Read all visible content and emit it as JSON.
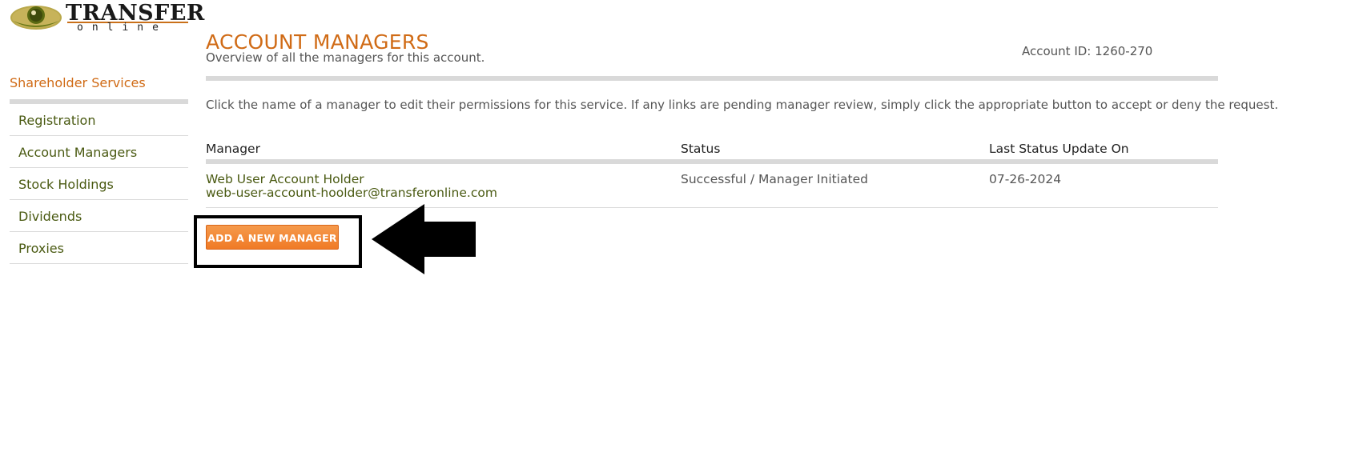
{
  "logo": {
    "main_text": "TRANSFER",
    "sub_text": "online",
    "icon": "eye-logo-icon",
    "colors": {
      "olive": "#6b7a18",
      "orange": "#c9701a"
    }
  },
  "sidebar": {
    "section_title": "Shareholder Services",
    "items": [
      {
        "label": "Registration"
      },
      {
        "label": "Account Managers"
      },
      {
        "label": "Stock Holdings"
      },
      {
        "label": "Dividends"
      },
      {
        "label": "Proxies"
      }
    ]
  },
  "header": {
    "title": "ACCOUNT MANAGERS",
    "subtitle": "Overview of all the managers for this account.",
    "account_id_label": "Account ID: 1260-270"
  },
  "instructions": "Click the name of a manager to edit their permissions for this service. If any links are pending manager review, simply click the appropriate button to accept or deny the request.",
  "table": {
    "columns": [
      "Manager",
      "Status",
      "Last Status Update On"
    ],
    "rows": [
      {
        "name": "Web User Account Holder",
        "email": "web-user-account-hoolder@transferonline.com",
        "status": "Successful / Manager Initiated",
        "date": "07-26-2024"
      }
    ]
  },
  "actions": {
    "add_manager_label": "ADD A NEW MANAGER"
  },
  "annotation": {
    "arrow_icon": "left-arrow-icon",
    "highlight": "highlight-box"
  },
  "colors": {
    "accent_orange": "#d06b16",
    "link_olive": "#4a5a12",
    "button_orange": "#f07a26",
    "rule_gray": "#d9d9d9"
  }
}
